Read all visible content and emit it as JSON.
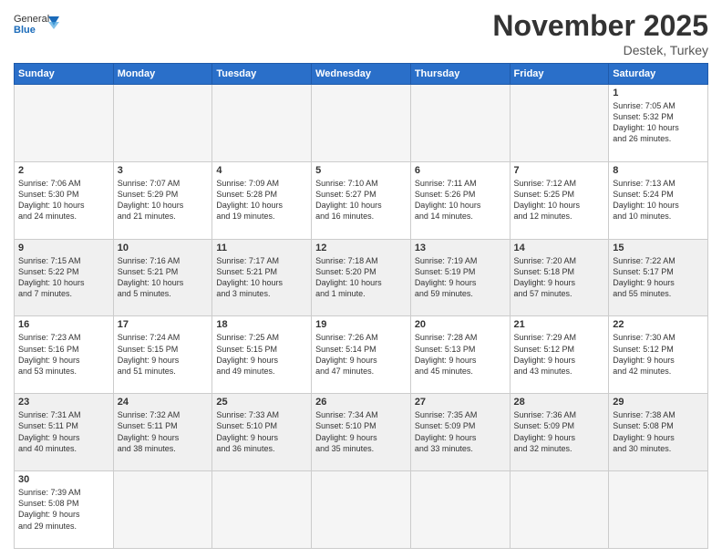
{
  "header": {
    "logo_general": "General",
    "logo_blue": "Blue",
    "month_title": "November 2025",
    "subtitle": "Destek, Turkey"
  },
  "weekdays": [
    "Sunday",
    "Monday",
    "Tuesday",
    "Wednesday",
    "Thursday",
    "Friday",
    "Saturday"
  ],
  "weeks": [
    [
      {
        "day": "",
        "info": "",
        "empty": true
      },
      {
        "day": "",
        "info": "",
        "empty": true
      },
      {
        "day": "",
        "info": "",
        "empty": true
      },
      {
        "day": "",
        "info": "",
        "empty": true
      },
      {
        "day": "",
        "info": "",
        "empty": true
      },
      {
        "day": "",
        "info": "",
        "empty": true
      },
      {
        "day": "1",
        "info": "Sunrise: 7:05 AM\nSunset: 5:32 PM\nDaylight: 10 hours\nand 26 minutes."
      }
    ],
    [
      {
        "day": "2",
        "info": "Sunrise: 7:06 AM\nSunset: 5:30 PM\nDaylight: 10 hours\nand 24 minutes."
      },
      {
        "day": "3",
        "info": "Sunrise: 7:07 AM\nSunset: 5:29 PM\nDaylight: 10 hours\nand 21 minutes."
      },
      {
        "day": "4",
        "info": "Sunrise: 7:09 AM\nSunset: 5:28 PM\nDaylight: 10 hours\nand 19 minutes."
      },
      {
        "day": "5",
        "info": "Sunrise: 7:10 AM\nSunset: 5:27 PM\nDaylight: 10 hours\nand 16 minutes."
      },
      {
        "day": "6",
        "info": "Sunrise: 7:11 AM\nSunset: 5:26 PM\nDaylight: 10 hours\nand 14 minutes."
      },
      {
        "day": "7",
        "info": "Sunrise: 7:12 AM\nSunset: 5:25 PM\nDaylight: 10 hours\nand 12 minutes."
      },
      {
        "day": "8",
        "info": "Sunrise: 7:13 AM\nSunset: 5:24 PM\nDaylight: 10 hours\nand 10 minutes."
      }
    ],
    [
      {
        "day": "9",
        "info": "Sunrise: 7:15 AM\nSunset: 5:22 PM\nDaylight: 10 hours\nand 7 minutes.",
        "shaded": true
      },
      {
        "day": "10",
        "info": "Sunrise: 7:16 AM\nSunset: 5:21 PM\nDaylight: 10 hours\nand 5 minutes.",
        "shaded": true
      },
      {
        "day": "11",
        "info": "Sunrise: 7:17 AM\nSunset: 5:21 PM\nDaylight: 10 hours\nand 3 minutes.",
        "shaded": true
      },
      {
        "day": "12",
        "info": "Sunrise: 7:18 AM\nSunset: 5:20 PM\nDaylight: 10 hours\nand 1 minute.",
        "shaded": true
      },
      {
        "day": "13",
        "info": "Sunrise: 7:19 AM\nSunset: 5:19 PM\nDaylight: 9 hours\nand 59 minutes.",
        "shaded": true
      },
      {
        "day": "14",
        "info": "Sunrise: 7:20 AM\nSunset: 5:18 PM\nDaylight: 9 hours\nand 57 minutes.",
        "shaded": true
      },
      {
        "day": "15",
        "info": "Sunrise: 7:22 AM\nSunset: 5:17 PM\nDaylight: 9 hours\nand 55 minutes.",
        "shaded": true
      }
    ],
    [
      {
        "day": "16",
        "info": "Sunrise: 7:23 AM\nSunset: 5:16 PM\nDaylight: 9 hours\nand 53 minutes."
      },
      {
        "day": "17",
        "info": "Sunrise: 7:24 AM\nSunset: 5:15 PM\nDaylight: 9 hours\nand 51 minutes."
      },
      {
        "day": "18",
        "info": "Sunrise: 7:25 AM\nSunset: 5:15 PM\nDaylight: 9 hours\nand 49 minutes."
      },
      {
        "day": "19",
        "info": "Sunrise: 7:26 AM\nSunset: 5:14 PM\nDaylight: 9 hours\nand 47 minutes."
      },
      {
        "day": "20",
        "info": "Sunrise: 7:28 AM\nSunset: 5:13 PM\nDaylight: 9 hours\nand 45 minutes."
      },
      {
        "day": "21",
        "info": "Sunrise: 7:29 AM\nSunset: 5:12 PM\nDaylight: 9 hours\nand 43 minutes."
      },
      {
        "day": "22",
        "info": "Sunrise: 7:30 AM\nSunset: 5:12 PM\nDaylight: 9 hours\nand 42 minutes."
      }
    ],
    [
      {
        "day": "23",
        "info": "Sunrise: 7:31 AM\nSunset: 5:11 PM\nDaylight: 9 hours\nand 40 minutes.",
        "shaded": true
      },
      {
        "day": "24",
        "info": "Sunrise: 7:32 AM\nSunset: 5:11 PM\nDaylight: 9 hours\nand 38 minutes.",
        "shaded": true
      },
      {
        "day": "25",
        "info": "Sunrise: 7:33 AM\nSunset: 5:10 PM\nDaylight: 9 hours\nand 36 minutes.",
        "shaded": true
      },
      {
        "day": "26",
        "info": "Sunrise: 7:34 AM\nSunset: 5:10 PM\nDaylight: 9 hours\nand 35 minutes.",
        "shaded": true
      },
      {
        "day": "27",
        "info": "Sunrise: 7:35 AM\nSunset: 5:09 PM\nDaylight: 9 hours\nand 33 minutes.",
        "shaded": true
      },
      {
        "day": "28",
        "info": "Sunrise: 7:36 AM\nSunset: 5:09 PM\nDaylight: 9 hours\nand 32 minutes.",
        "shaded": true
      },
      {
        "day": "29",
        "info": "Sunrise: 7:38 AM\nSunset: 5:08 PM\nDaylight: 9 hours\nand 30 minutes.",
        "shaded": true
      }
    ],
    [
      {
        "day": "30",
        "info": "Sunrise: 7:39 AM\nSunset: 5:08 PM\nDaylight: 9 hours\nand 29 minutes."
      },
      {
        "day": "",
        "info": "",
        "empty": true
      },
      {
        "day": "",
        "info": "",
        "empty": true
      },
      {
        "day": "",
        "info": "",
        "empty": true
      },
      {
        "day": "",
        "info": "",
        "empty": true
      },
      {
        "day": "",
        "info": "",
        "empty": true
      },
      {
        "day": "",
        "info": "",
        "empty": true
      }
    ]
  ]
}
